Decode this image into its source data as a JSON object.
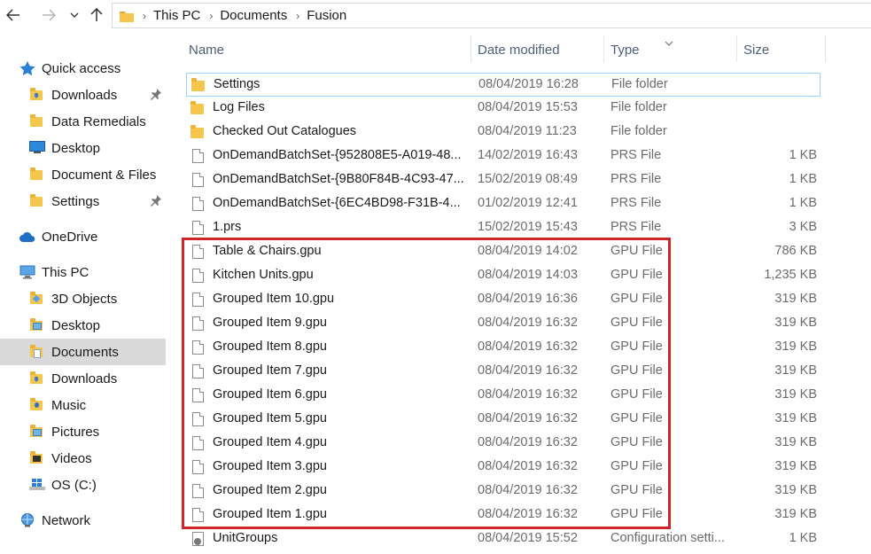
{
  "address": {
    "crumbs": [
      "This PC",
      "Documents",
      "Fusion"
    ]
  },
  "sidebar": {
    "items": [
      {
        "label": "Quick access",
        "icon": "star-icon",
        "indent": 0,
        "pinned": false,
        "active": false
      },
      {
        "label": "Downloads",
        "icon": "downloads-folder-icon",
        "indent": 1,
        "pinned": true,
        "active": false
      },
      {
        "label": "Data Remedials",
        "icon": "folder-icon",
        "indent": 1,
        "pinned": false,
        "active": false
      },
      {
        "label": "Desktop",
        "icon": "desktop-icon",
        "indent": 1,
        "pinned": false,
        "active": false
      },
      {
        "label": "Document & Files",
        "icon": "folder-icon",
        "indent": 1,
        "pinned": false,
        "active": false
      },
      {
        "label": "Settings",
        "icon": "folder-icon",
        "indent": 1,
        "pinned": true,
        "active": false
      },
      {
        "label": "OneDrive",
        "icon": "cloud-icon",
        "indent": 0,
        "pinned": false,
        "active": false
      },
      {
        "label": "This PC",
        "icon": "computer-icon",
        "indent": 0,
        "pinned": false,
        "active": false
      },
      {
        "label": "3D Objects",
        "icon": "3d-objects-folder-icon",
        "indent": 1,
        "pinned": false,
        "active": false
      },
      {
        "label": "Desktop",
        "icon": "desktop-folder-icon",
        "indent": 1,
        "pinned": false,
        "active": false
      },
      {
        "label": "Documents",
        "icon": "documents-folder-icon",
        "indent": 1,
        "pinned": false,
        "active": true
      },
      {
        "label": "Downloads",
        "icon": "downloads-folder-icon",
        "indent": 1,
        "pinned": false,
        "active": false
      },
      {
        "label": "Music",
        "icon": "music-folder-icon",
        "indent": 1,
        "pinned": false,
        "active": false
      },
      {
        "label": "Pictures",
        "icon": "pictures-folder-icon",
        "indent": 1,
        "pinned": false,
        "active": false
      },
      {
        "label": "Videos",
        "icon": "videos-folder-icon",
        "indent": 1,
        "pinned": false,
        "active": false
      },
      {
        "label": "OS (C:)",
        "icon": "drive-icon",
        "indent": 1,
        "pinned": false,
        "active": false
      },
      {
        "label": "Network",
        "icon": "network-icon",
        "indent": 0,
        "pinned": false,
        "active": false
      }
    ]
  },
  "columns": {
    "name": "Name",
    "date": "Date modified",
    "type": "Type",
    "size": "Size"
  },
  "files": [
    {
      "name": "Settings",
      "date": "08/04/2019 16:28",
      "type": "File folder",
      "size": "",
      "kind": "folder",
      "selected": true
    },
    {
      "name": "Log Files",
      "date": "08/04/2019 15:53",
      "type": "File folder",
      "size": "",
      "kind": "folder",
      "selected": false
    },
    {
      "name": "Checked Out Catalogues",
      "date": "08/04/2019 11:23",
      "type": "File folder",
      "size": "",
      "kind": "folder",
      "selected": false
    },
    {
      "name": "OnDemandBatchSet-{952808E5-A019-48...",
      "date": "14/02/2019 16:43",
      "type": "PRS File",
      "size": "1 KB",
      "kind": "doc",
      "selected": false
    },
    {
      "name": "OnDemandBatchSet-{9B80F84B-4C93-47...",
      "date": "15/02/2019 08:49",
      "type": "PRS File",
      "size": "1 KB",
      "kind": "doc",
      "selected": false
    },
    {
      "name": "OnDemandBatchSet-{6EC4BD98-F31B-4...",
      "date": "01/02/2019 12:41",
      "type": "PRS File",
      "size": "1 KB",
      "kind": "doc",
      "selected": false
    },
    {
      "name": "1.prs",
      "date": "15/02/2019 15:43",
      "type": "PRS File",
      "size": "3 KB",
      "kind": "doc",
      "selected": false
    },
    {
      "name": "Table & Chairs.gpu",
      "date": "08/04/2019 14:02",
      "type": "GPU File",
      "size": "786 KB",
      "kind": "doc",
      "selected": false
    },
    {
      "name": "Kitchen Units.gpu",
      "date": "08/04/2019 14:03",
      "type": "GPU File",
      "size": "1,235 KB",
      "kind": "doc",
      "selected": false
    },
    {
      "name": "Grouped Item 10.gpu",
      "date": "08/04/2019 16:36",
      "type": "GPU File",
      "size": "319 KB",
      "kind": "doc",
      "selected": false
    },
    {
      "name": "Grouped Item 9.gpu",
      "date": "08/04/2019 16:32",
      "type": "GPU File",
      "size": "319 KB",
      "kind": "doc",
      "selected": false
    },
    {
      "name": "Grouped Item 8.gpu",
      "date": "08/04/2019 16:32",
      "type": "GPU File",
      "size": "319 KB",
      "kind": "doc",
      "selected": false
    },
    {
      "name": "Grouped Item 7.gpu",
      "date": "08/04/2019 16:32",
      "type": "GPU File",
      "size": "319 KB",
      "kind": "doc",
      "selected": false
    },
    {
      "name": "Grouped Item 6.gpu",
      "date": "08/04/2019 16:32",
      "type": "GPU File",
      "size": "319 KB",
      "kind": "doc",
      "selected": false
    },
    {
      "name": "Grouped Item 5.gpu",
      "date": "08/04/2019 16:32",
      "type": "GPU File",
      "size": "319 KB",
      "kind": "doc",
      "selected": false
    },
    {
      "name": "Grouped Item 4.gpu",
      "date": "08/04/2019 16:32",
      "type": "GPU File",
      "size": "319 KB",
      "kind": "doc",
      "selected": false
    },
    {
      "name": "Grouped Item 3.gpu",
      "date": "08/04/2019 16:32",
      "type": "GPU File",
      "size": "319 KB",
      "kind": "doc",
      "selected": false
    },
    {
      "name": "Grouped Item 2.gpu",
      "date": "08/04/2019 16:32",
      "type": "GPU File",
      "size": "319 KB",
      "kind": "doc",
      "selected": false
    },
    {
      "name": "Grouped Item 1.gpu",
      "date": "08/04/2019 16:32",
      "type": "GPU File",
      "size": "319 KB",
      "kind": "doc",
      "selected": false
    },
    {
      "name": "UnitGroups",
      "date": "08/04/2019 15:52",
      "type": "Configuration setti...",
      "size": "1 KB",
      "kind": "config",
      "selected": false
    }
  ],
  "colors": {
    "highlight": "#d1232a",
    "selection_border": "#99d1ff",
    "active_nav": "#d9d9d9"
  }
}
